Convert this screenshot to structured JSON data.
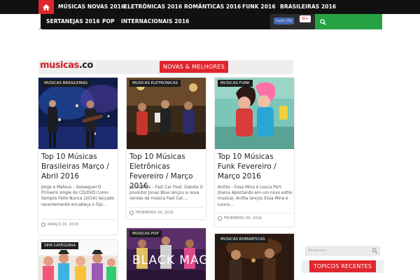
{
  "nav": {
    "row1": [
      "MÚSICAS NOVAS 2016",
      "ELETRÔNICAS 2016",
      "ROMÂNTICAS 2016",
      "FUNK 2016",
      "BRASILEIRAS 2016"
    ],
    "row2": [
      "SERTANEJAS 2016",
      "POP",
      "INTERNACIONAIS 2016"
    ],
    "fb_like": "Curtir 150",
    "gplus": "G+",
    "home_icon": "home-icon",
    "search_icon": "search-icon"
  },
  "section": {
    "logo_main": "musicas",
    "logo_suffix": ".co",
    "label": "NOVAS & MELHORES"
  },
  "cards": [
    {
      "category": "MUSICAS BRASILEIRAS",
      "title": "Top 10 Músicas Brasileiras Março / Abril 2016",
      "excerpt": "Jorge e Mateus – Sosseguei O Primeiro single do CD/DVD Como Sempre Feito Nunca (2016) lançado recentemente encabeça o Top…",
      "date": "MARÇO 24, 2016"
    },
    {
      "category": "MUSICAS ELETRONICAS",
      "title": "Top 10 Músicas Eletrônicas Fevereiro / Março 2016",
      "excerpt": "Jonas Blue – Fast Car Feat. Dakota O produtor Jonas Blue lançou a nova versão da música Fast Car,…",
      "date": "FEVEREIRO 29, 2016"
    },
    {
      "category": "MUSICAS FUNK",
      "title": "Top 10 Músicas Funk Fevereiro / Março 2016",
      "excerpt": "Anitta – Essa Mina é Louca Part. Jhama Apostando em um novo estilo musical, Anitta lançou Essa Mina é Louca…",
      "date": "FEVEREIRO 29, 2016"
    },
    {
      "category": "SEM CATEGORIA"
    },
    {
      "category": "MUSICAS POP",
      "image_text": "BLACK MAG"
    },
    {
      "category": "MUSICAS ROMANTICAS"
    }
  ],
  "sidebar": {
    "search_placeholder": "Pesquisar...",
    "title": "TOPICOS RECENTES"
  },
  "colors": {
    "accent": "#e0262c",
    "nav_dark": "#111111",
    "green": "#27a243"
  }
}
